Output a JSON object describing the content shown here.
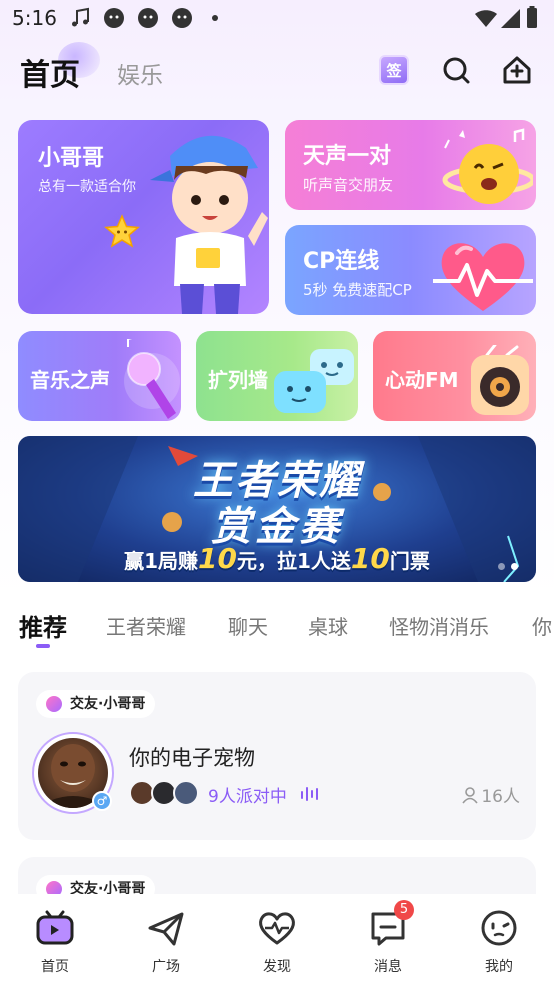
{
  "status_bar": {
    "time": "5:16"
  },
  "top_nav": {
    "tabs": [
      {
        "label": "首页",
        "active": true
      },
      {
        "label": "娱乐",
        "active": false
      }
    ],
    "sign_in_label": "签"
  },
  "cards": {
    "boy": {
      "title": "小哥哥",
      "subtitle": "总有一款适合你"
    },
    "voice": {
      "title": "天声一对",
      "subtitle": "听声音交朋友"
    },
    "cp": {
      "title": "CP连线",
      "subtitle": "5秒 免费速配CP"
    },
    "music": {
      "title": "音乐之声"
    },
    "wall": {
      "title": "扩列墙"
    },
    "fm": {
      "title": "心动FM"
    }
  },
  "banner": {
    "line1": "王者荣耀",
    "line2": "赏金赛",
    "sub_parts": [
      "赢1局赚",
      "10",
      "元，拉1人送",
      "10",
      "门票"
    ],
    "pages": 2,
    "current_page": 2
  },
  "category_tabs": {
    "items": [
      "推荐",
      "王者荣耀",
      "聊天",
      "桌球",
      "怪物消消乐",
      "你"
    ],
    "active_index": 0
  },
  "rooms": [
    {
      "tag": "交友·小哥哥",
      "title": "你的电子宠物",
      "party_text": "9人派对中",
      "people": "16人",
      "gender": "♂"
    },
    {
      "tag": "交友·小哥哥"
    }
  ],
  "bottom_nav": {
    "items": [
      {
        "label": "首页",
        "icon": "tv-home-icon",
        "active": true
      },
      {
        "label": "广场",
        "icon": "paper-plane-icon"
      },
      {
        "label": "发现",
        "icon": "heart-pulse-icon"
      },
      {
        "label": "消息",
        "icon": "message-icon",
        "badge": "5"
      },
      {
        "label": "我的",
        "icon": "face-icon"
      }
    ]
  },
  "colors": {
    "accent": "#8b5cf6",
    "badge": "#f04848"
  }
}
